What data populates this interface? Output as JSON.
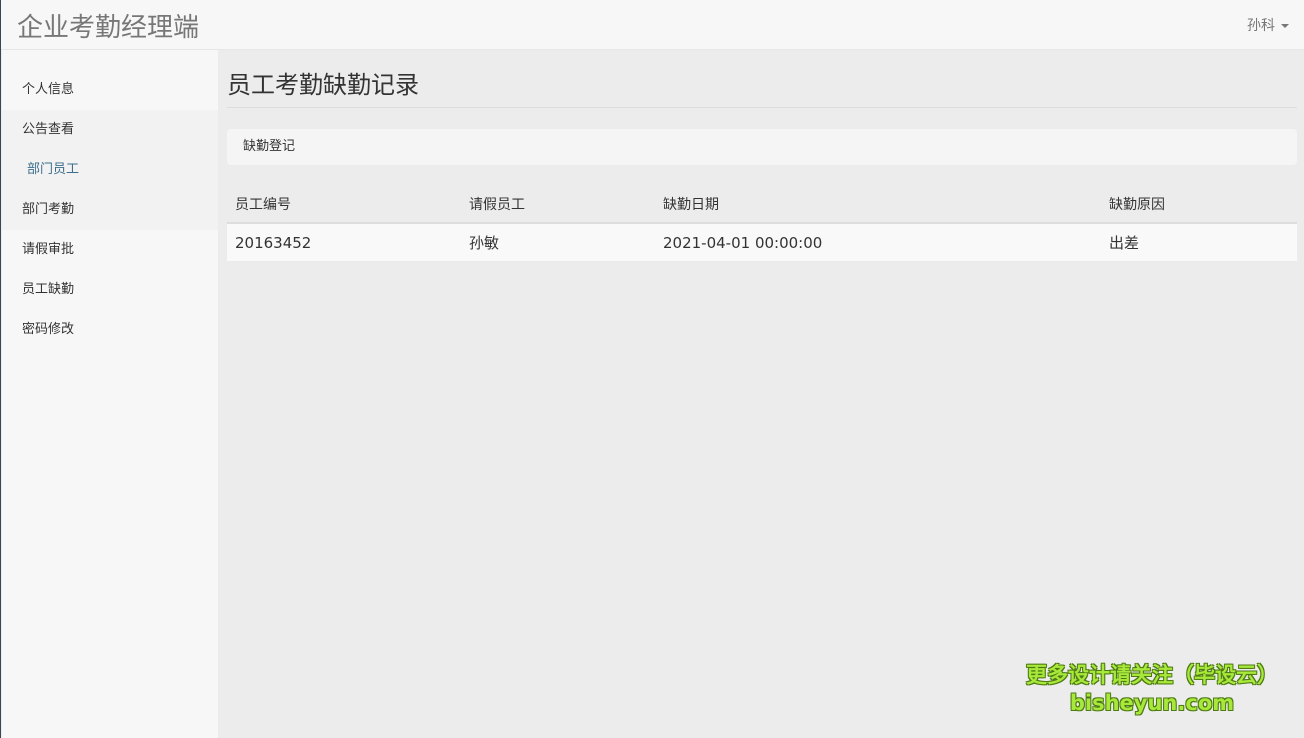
{
  "navbar": {
    "brand": "企业考勤经理端",
    "user": "孙科"
  },
  "sidebar": {
    "items": [
      {
        "label": "个人信息"
      },
      {
        "label": "公告查看"
      },
      {
        "label": "部门员工"
      },
      {
        "label": "部门考勤"
      },
      {
        "label": "请假审批"
      },
      {
        "label": "员工缺勤"
      },
      {
        "label": "密码修改"
      }
    ]
  },
  "main": {
    "title": "员工考勤缺勤记录",
    "breadcrumb": "缺勤登记",
    "table": {
      "headers": [
        "员工编号",
        "请假员工",
        "缺勤日期",
        "缺勤原因"
      ],
      "rows": [
        [
          "20163452",
          "孙敏",
          "2021-04-01 00:00:00",
          "出差"
        ]
      ]
    }
  },
  "watermark": {
    "line1": "更多设计请关注（毕设云）",
    "line2": "bisheyun.com"
  }
}
